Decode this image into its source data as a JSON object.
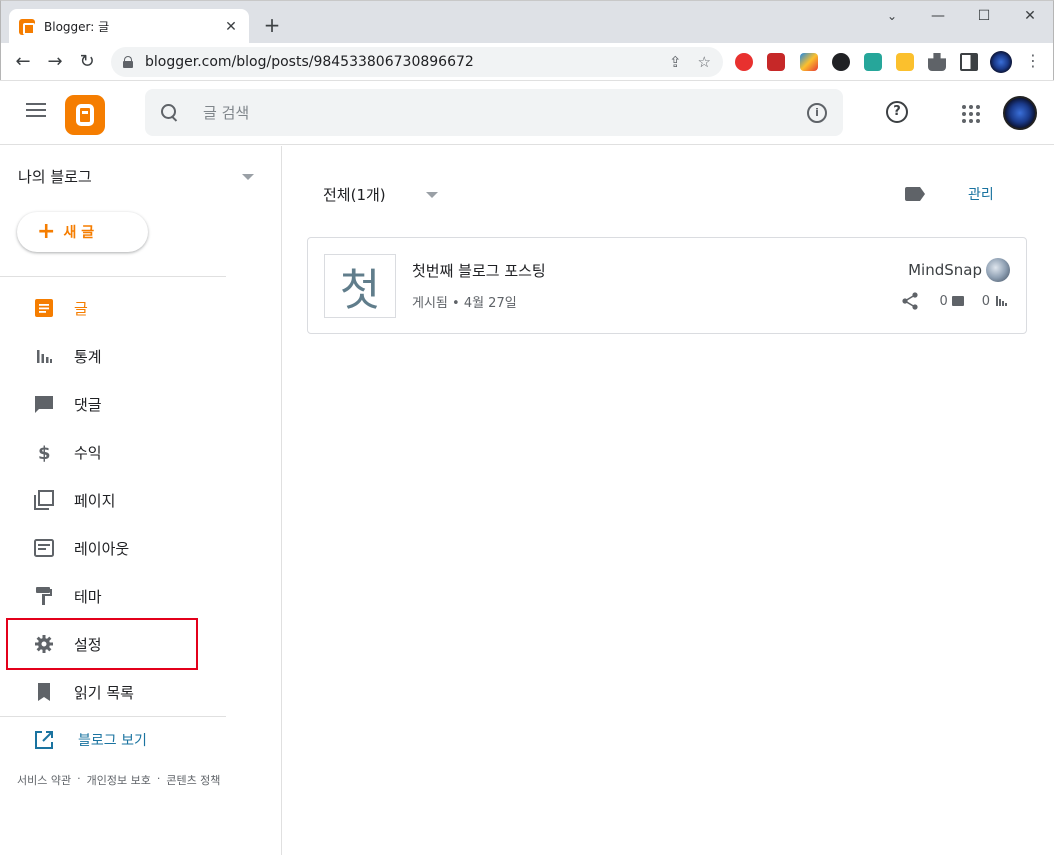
{
  "browser": {
    "tab_title": "Blogger: 글",
    "tab_close": "✕",
    "new_tab": "+",
    "minimize": "—",
    "maximize": "☐",
    "close": "✕",
    "url": "blogger.com/blog/posts/984533806730896672",
    "back": "←",
    "forward": "→",
    "reload": "↻",
    "share_icon": "⇪",
    "bookmark_icon": "☆",
    "menu_icon": "⋮"
  },
  "header": {
    "search_placeholder": "글 검색",
    "info": "i",
    "help": "?"
  },
  "sidebar": {
    "blog_name": "나의 블로그",
    "new_post": "새 글",
    "items": [
      {
        "label": "글",
        "icon": "posts-icon"
      },
      {
        "label": "통계",
        "icon": "stats-icon"
      },
      {
        "label": "댓글",
        "icon": "comments-icon"
      },
      {
        "label": "수익",
        "icon": "earnings-icon"
      },
      {
        "label": "페이지",
        "icon": "pages-icon"
      },
      {
        "label": "레이아웃",
        "icon": "layout-icon"
      },
      {
        "label": "테마",
        "icon": "theme-icon"
      },
      {
        "label": "설정",
        "icon": "settings-icon"
      },
      {
        "label": "읽기 목록",
        "icon": "reading-list-icon"
      }
    ],
    "view_blog": "블로그 보기",
    "footer": [
      "서비스 약관",
      "·",
      "개인정보 보호",
      "·",
      "콘텐츠 정책"
    ]
  },
  "main": {
    "filter_label": "전체(1개)",
    "manage": "관리",
    "post": {
      "thumb_char": "첫",
      "title": "첫번째 블로그 포스팅",
      "meta": "게시됨 • 4월 27일",
      "author": "MindSnap",
      "comments": "0",
      "views": "0"
    }
  },
  "colors": {
    "accent": "#f57d00",
    "link": "#1a73a0",
    "highlight": "#e3001b"
  }
}
